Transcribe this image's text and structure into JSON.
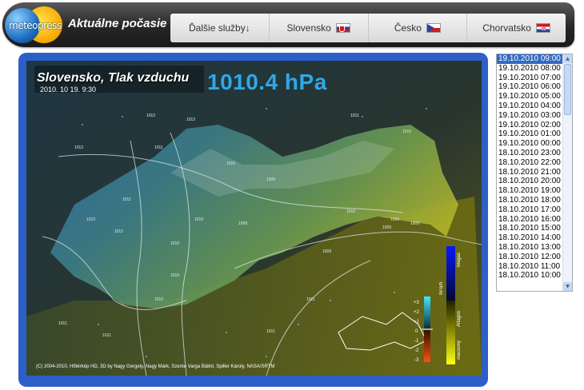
{
  "header": {
    "logo_text": "meteopress",
    "title": "Aktuálne počasie"
  },
  "nav": {
    "items": [
      {
        "label": "Ďalšie služby↓"
      },
      {
        "label": "Slovensko",
        "flag": "sk"
      },
      {
        "label": "Česko",
        "flag": "cz"
      },
      {
        "label": "Chorvatsko",
        "flag": "hr"
      }
    ]
  },
  "map": {
    "title": "Slovensko, Tlak vzduchu",
    "date": "2010. 10 19. 9:30",
    "value": "1010.4 hPa",
    "copyright": "(C) 2004-2010. Hőtérkép HD, 3D by Nagy Gergely, Nagy Márk, Szente Varga Bálint, Spiller Károly, NASA/SRTM",
    "isobar_labels": [
      "1012",
      "1012",
      "1011",
      "1012",
      "1011",
      "1010",
      "1010",
      "1009",
      "1009",
      "1011",
      "1010",
      "1010",
      "1009",
      "1009",
      "1009",
      "1011",
      "1011",
      "1010",
      "1011",
      "1009",
      "1012",
      "1010",
      "1011",
      "1010",
      "1012"
    ],
    "legend": {
      "high_label": "Magas",
      "mid_label": "Átlagos",
      "low_label": "Alacsony",
      "unit": "hPa/h",
      "ticks": [
        "+3",
        "+2",
        "+1",
        "0",
        "-1",
        "-2",
        "-3"
      ]
    },
    "colors": {
      "panel_border": "#2d5fc9",
      "value_text": "#2fa8e8"
    }
  },
  "times": {
    "selected_index": 0,
    "items": [
      "19.10.2010 09:00",
      "19.10.2010 08:00",
      "19.10.2010 07:00",
      "19.10.2010 06:00",
      "19.10.2010 05:00",
      "19.10.2010 04:00",
      "19.10.2010 03:00",
      "19.10.2010 02:00",
      "19.10.2010 01:00",
      "19.10.2010 00:00",
      "18.10.2010 23:00",
      "18.10.2010 22:00",
      "18.10.2010 21:00",
      "18.10.2010 20:00",
      "18.10.2010 19:00",
      "18.10.2010 18:00",
      "18.10.2010 17:00",
      "18.10.2010 16:00",
      "18.10.2010 15:00",
      "18.10.2010 14:00",
      "18.10.2010 13:00",
      "18.10.2010 12:00",
      "18.10.2010 11:00",
      "18.10.2010 10:00"
    ]
  }
}
